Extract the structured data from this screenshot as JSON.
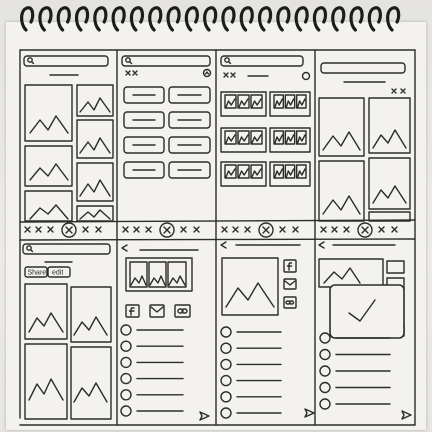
{
  "sketch": {
    "frame2": {
      "share_label": "Share",
      "edit_label": "edit"
    },
    "icons": {
      "search": "search-icon",
      "close": "x-icon",
      "back": "arrow-left-icon",
      "send": "send-icon",
      "facebook": "facebook-icon",
      "mail": "mail-icon",
      "link": "link-icon",
      "check": "check-icon",
      "image": "image-placeholder-icon"
    }
  }
}
